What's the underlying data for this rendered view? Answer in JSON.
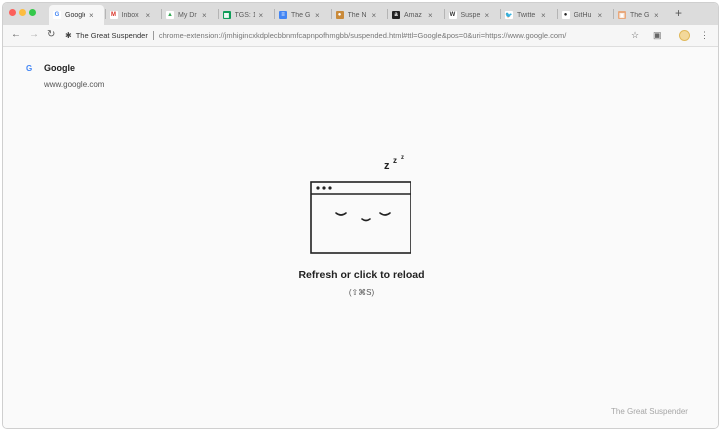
{
  "browser": {
    "tabs": [
      {
        "title": "Google",
        "favicon": "google-g",
        "icon_color": "#ffffff",
        "icon_text": "G",
        "text_color": "#4285f4",
        "active": true
      },
      {
        "title": "Inbox",
        "favicon": "gmail",
        "icon_color": "#ffffff",
        "icon_text": "M",
        "text_color": "#d93025",
        "active": false
      },
      {
        "title": "My Dr",
        "favicon": "drive",
        "icon_color": "#ffffff",
        "icon_text": "▲",
        "text_color": "#34a853",
        "active": false
      },
      {
        "title": "TGS: 1",
        "favicon": "sheets",
        "icon_color": "#0f9d58",
        "icon_text": "▦",
        "text_color": "#ffffff",
        "active": false
      },
      {
        "title": "The G",
        "favicon": "docs",
        "icon_color": "#4285f4",
        "icon_text": "≡",
        "text_color": "#ffffff",
        "active": false
      },
      {
        "title": "The N",
        "favicon": "circle",
        "icon_color": "#c98a3a",
        "icon_text": "●",
        "text_color": "#ffffff",
        "active": false
      },
      {
        "title": "Amaz",
        "favicon": "amazon",
        "icon_color": "#222222",
        "icon_text": "a",
        "text_color": "#ffffff",
        "active": false
      },
      {
        "title": "Suspe",
        "favicon": "wikipedia",
        "icon_color": "#ffffff",
        "icon_text": "W",
        "text_color": "#333333",
        "active": false
      },
      {
        "title": "Twitte",
        "favicon": "twitter",
        "icon_color": "#ffffff",
        "icon_text": "🐦",
        "text_color": "#1da1f2",
        "active": false
      },
      {
        "title": "GitHu",
        "favicon": "github",
        "icon_color": "#ffffff",
        "icon_text": "●",
        "text_color": "#222222",
        "active": false
      },
      {
        "title": "The G",
        "favicon": "suspender",
        "icon_color": "#e8a87c",
        "icon_text": "▣",
        "text_color": "#ffffff",
        "active": false
      }
    ],
    "new_tab_label": "+",
    "omnibox": {
      "extension_name": "The Great Suspender",
      "url": "chrome-extension://jmhigincxkdplecbbnmfcapnpofhmgbb/suspended.html#ttl=Google&pos=0&uri=https://www.google.com/"
    }
  },
  "page": {
    "site_title": "Google",
    "site_url": "www.google.com",
    "sleep_text": "z",
    "reload_text": "Refresh or click to reload",
    "hotkey": "(⇧⌘S)",
    "footer_brand": "The Great Suspender"
  },
  "icons": {
    "back": "back-arrow-icon",
    "forward": "forward-arrow-icon",
    "reload": "reload-icon",
    "bookmark": "star-icon",
    "extension": "extension-icon",
    "profile": "avatar"
  }
}
